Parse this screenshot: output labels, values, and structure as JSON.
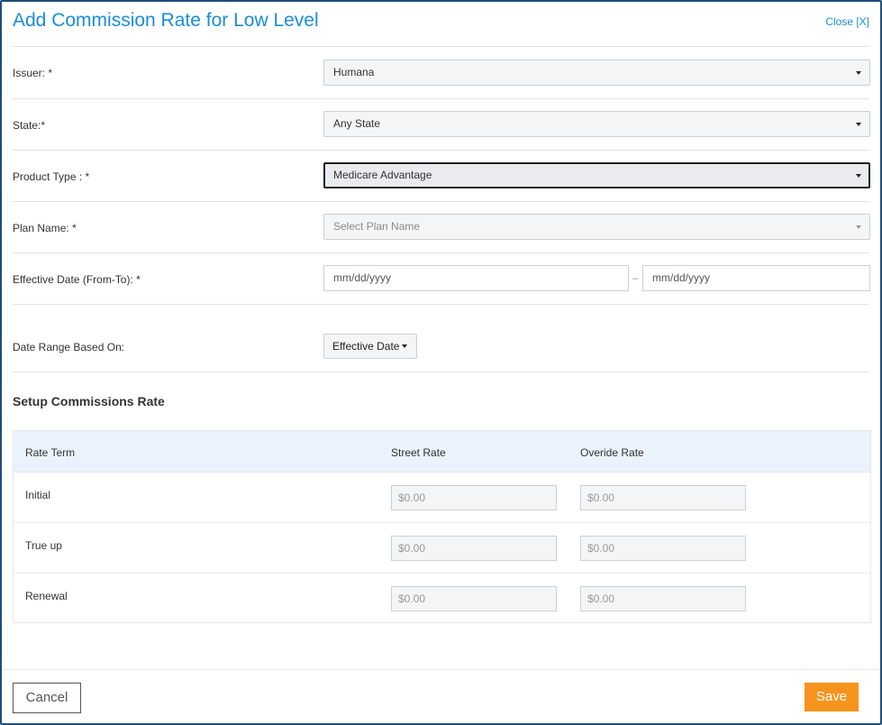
{
  "dialog": {
    "title": "Add Commission Rate for Low Level",
    "close_label": "Close [X]"
  },
  "form": {
    "issuer": {
      "label": "Issuer: *",
      "value": "Humana"
    },
    "state": {
      "label": "State:*",
      "value": "Any State"
    },
    "product_type": {
      "label": "Product Type : *",
      "value": "Medicare Advantage"
    },
    "plan_name": {
      "label": "Plan Name: *",
      "placeholder": "Select Plan Name"
    },
    "effective_date": {
      "label": "Effective Date (From-To): *",
      "from_placeholder": "mm/dd/yyyy",
      "to_placeholder": "mm/dd/yyyy",
      "separator": "–"
    },
    "date_range": {
      "label": "Date Range Based On:",
      "value": "Effective Date"
    }
  },
  "commissions": {
    "section_title": "Setup Commissions Rate",
    "headers": {
      "term": "Rate Term",
      "street": "Street Rate",
      "override": "Overide Rate"
    },
    "rows": [
      {
        "term": "Initial",
        "street": "$0.00",
        "override": "$0.00"
      },
      {
        "term": "True up",
        "street": "$0.00",
        "override": "$0.00"
      },
      {
        "term": "Renewal",
        "street": "$0.00",
        "override": "$0.00"
      }
    ]
  },
  "footer": {
    "cancel_label": "Cancel",
    "save_label": "Save"
  },
  "colors": {
    "accent": "#1a8cd8",
    "save": "#f7941d",
    "header_bg": "#eaf3fb",
    "border": "#1f4e79"
  }
}
